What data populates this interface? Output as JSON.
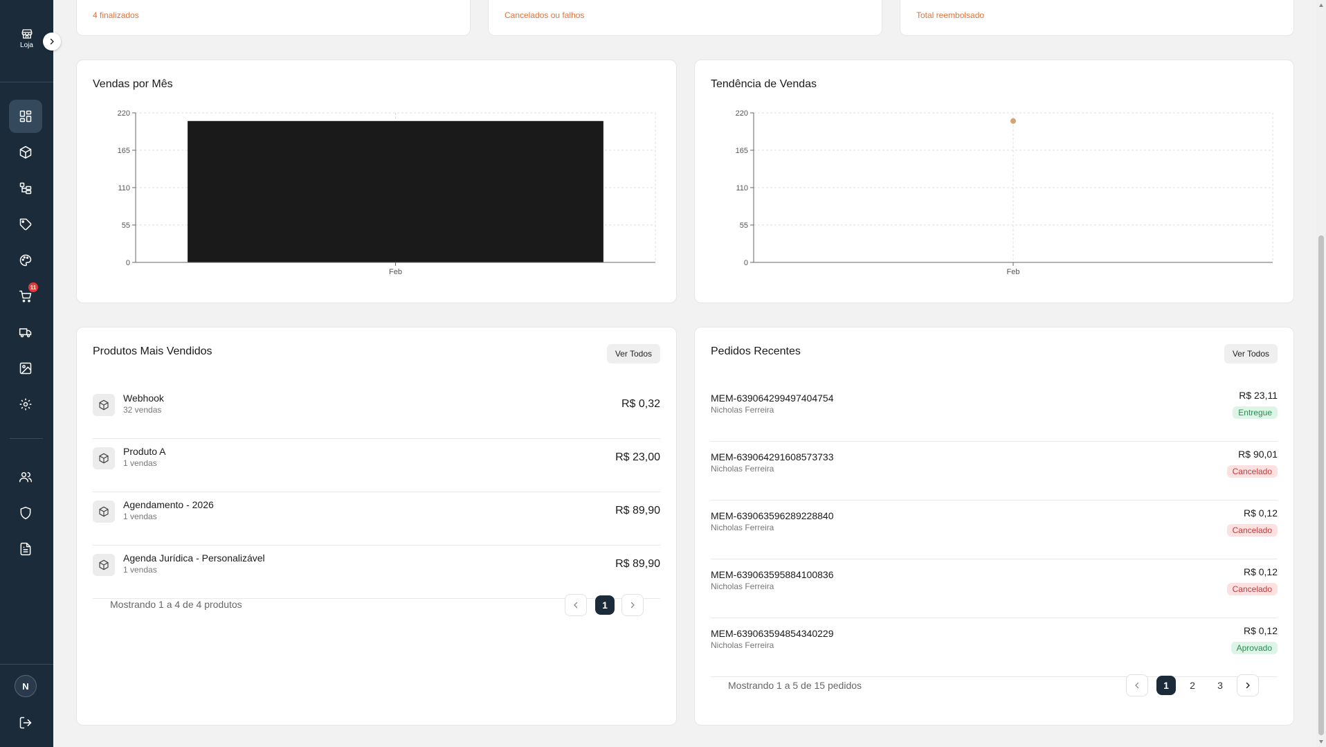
{
  "sidebar": {
    "brand_label": "Loja",
    "cart_badge": "11",
    "avatar_initial": "N",
    "items": [
      {
        "icon": "dashboard-icon",
        "active": true
      },
      {
        "icon": "box-icon"
      },
      {
        "icon": "categories-icon"
      },
      {
        "icon": "tag-icon"
      },
      {
        "icon": "palette-icon"
      },
      {
        "icon": "cart-icon"
      },
      {
        "icon": "truck-icon"
      },
      {
        "icon": "image-icon"
      },
      {
        "icon": "gear-icon"
      },
      {
        "icon": "users-icon"
      },
      {
        "icon": "shield-icon"
      },
      {
        "icon": "document-icon"
      }
    ]
  },
  "stats": [
    {
      "note": "4 finalizados"
    },
    {
      "note": "Cancelados ou falhos"
    },
    {
      "note": "Total reembolsado"
    }
  ],
  "sales_chart": {
    "title": "Vendas por Mês"
  },
  "trend_chart": {
    "title": "Tendência de Vendas"
  },
  "chart_data": [
    {
      "type": "bar",
      "title": "Vendas por Mês",
      "categories": [
        "Feb"
      ],
      "values": [
        208
      ],
      "ylim": [
        0,
        220
      ],
      "yticks": [
        0,
        55,
        110,
        165,
        220
      ],
      "grid": true,
      "color": "#1a1a1a"
    },
    {
      "type": "line",
      "title": "Tendência de Vendas",
      "categories": [
        "Feb"
      ],
      "values": [
        208
      ],
      "ylim": [
        0,
        220
      ],
      "yticks": [
        0,
        55,
        110,
        165,
        220
      ],
      "grid": true,
      "color": "#d4a373"
    }
  ],
  "products": {
    "title": "Produtos Mais Vendidos",
    "view_all": "Ver Todos",
    "items": [
      {
        "name": "Webhook",
        "sales": "32 vendas",
        "price": "R$ 0,32"
      },
      {
        "name": "Produto A",
        "sales": "1 vendas",
        "price": "R$ 23,00"
      },
      {
        "name": "Agendamento - 2026",
        "sales": "1 vendas",
        "price": "R$ 89,90"
      },
      {
        "name": "Agenda Jurídica - Personalizável",
        "sales": "1 vendas",
        "price": "R$ 89,90"
      }
    ],
    "pagination_text": "Mostrando 1 a 4 de 4 produtos",
    "pages": [
      "1"
    ]
  },
  "orders": {
    "title": "Pedidos Recentes",
    "view_all": "Ver Todos",
    "items": [
      {
        "id": "MEM-639064299497404754",
        "customer": "Nicholas Ferreira",
        "price": "R$ 23,11",
        "status": "Entregue",
        "status_class": "entregue"
      },
      {
        "id": "MEM-639064291608573733",
        "customer": "Nicholas Ferreira",
        "price": "R$ 90,01",
        "status": "Cancelado",
        "status_class": "cancelado"
      },
      {
        "id": "MEM-639063596289228840",
        "customer": "Nicholas Ferreira",
        "price": "R$ 0,12",
        "status": "Cancelado",
        "status_class": "cancelado"
      },
      {
        "id": "MEM-639063595884100836",
        "customer": "Nicholas Ferreira",
        "price": "R$ 0,12",
        "status": "Cancelado",
        "status_class": "cancelado"
      },
      {
        "id": "MEM-639063594854340229",
        "customer": "Nicholas Ferreira",
        "price": "R$ 0,12",
        "status": "Aprovado",
        "status_class": "aprovado"
      }
    ],
    "pagination_text": "Mostrando 1 a 5 de 15 pedidos",
    "pages": [
      "1",
      "2",
      "3"
    ]
  }
}
